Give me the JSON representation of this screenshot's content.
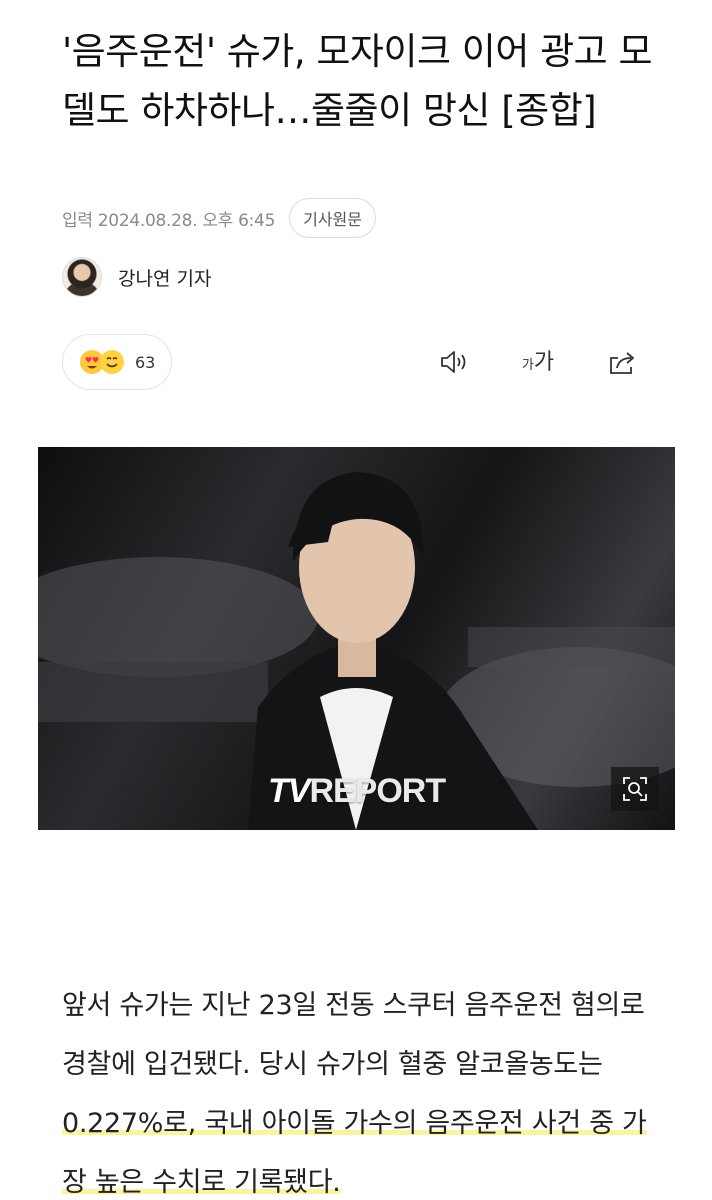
{
  "article": {
    "headline": "'음주운전' 슈가, 모자이크 이어 광고 모델도 하차하나…줄줄이 망신 [종합]",
    "published": "입력 2024.08.28. 오후 6:45",
    "source_button": "기사원문",
    "author": "강나연 기자",
    "reaction_count": "63",
    "font_size_small": "가",
    "font_size_large": "가",
    "watermark_t": "TV",
    "watermark_report": "REPORT",
    "body_plain_1": "앞서 슈가는 지난 23일 전동 스쿠터 음주운전 혐의로 경찰에 입건됐다. 당시 슈가의 혈중 알코올농도는 ",
    "body_highlight": "0.227%로, 국내 아이돌 가수의 음주운전 사건 중 가장 높은 수치로 기록됐다."
  },
  "colors": {
    "highlight": "#fbf39f",
    "text": "#222222",
    "muted": "#8a8a8a"
  },
  "icons": [
    "heart-eyes-emoji-icon",
    "smile-emoji-icon",
    "speaker-icon",
    "share-icon",
    "zoom-icon"
  ]
}
